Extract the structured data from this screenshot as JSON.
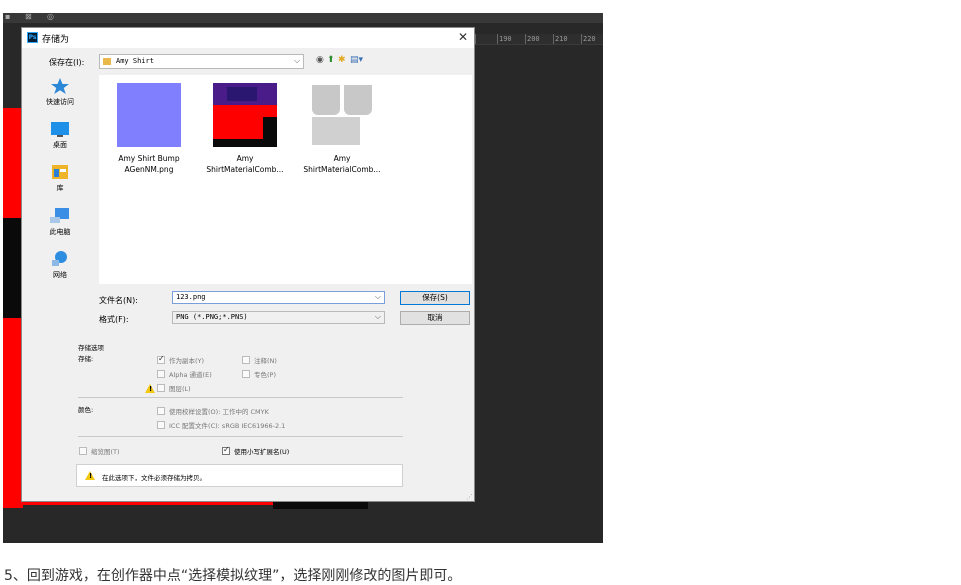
{
  "ps": {
    "topbar": {
      "item1": "▪",
      "item2": "⊠",
      "item3": "◎"
    },
    "ruler_ticks": [
      "190",
      "200",
      "210",
      "220"
    ]
  },
  "dialog": {
    "title": "存储为",
    "app_icon_label": "Ps",
    "close_glyph": "✕",
    "location_label": "保存在(I):",
    "location_value": "Amy Shirt",
    "sidebar": [
      {
        "label": "快速访问",
        "icon": "star-icon"
      },
      {
        "label": "桌面",
        "icon": "desktop-icon"
      },
      {
        "label": "库",
        "icon": "library-icon"
      },
      {
        "label": "此电脑",
        "icon": "computer-icon"
      },
      {
        "label": "网络",
        "icon": "network-icon"
      }
    ],
    "files": [
      {
        "name_line1": "Amy Shirt Bump",
        "name_line2": "AGenNM.png"
      },
      {
        "name_line1": "Amy",
        "name_line2": "ShirtMaterialComb..."
      },
      {
        "name_line1": "Amy",
        "name_line2": "ShirtMaterialComb..."
      }
    ],
    "filename_label": "文件名(N):",
    "filename_value": "123.png",
    "format_label": "格式(F):",
    "format_value": "PNG (*.PNG;*.PNS)",
    "save_button": "保存(S)",
    "cancel_button": "取消",
    "options": {
      "section_title": "存储选项",
      "storage_label": "存储:",
      "as_copy": "作为副本(Y)",
      "notes": "注释(N)",
      "alpha": "Alpha 通道(E)",
      "spot": "专色(P)",
      "layers": "图层(L)",
      "color_label": "颜色:",
      "proof": "使用校样设置(O):  工作中的 CMYK",
      "icc": "ICC 配置文件(C):  sRGB IEC61966-2.1",
      "thumbnail": "缩览图(T)",
      "lowercase_ext": "使用小写扩展名(U)",
      "warning": "在此选项下，文件必须存储为拷贝。"
    }
  },
  "caption": "5、回到游戏，在创作器中点“选择模拟纹理”，选择刚刚修改的图片即可。",
  "colors": {
    "accent": "#0078d7",
    "ps_red": "#ff0000",
    "ps_bg": "#282828",
    "bump": "#8080ff"
  }
}
